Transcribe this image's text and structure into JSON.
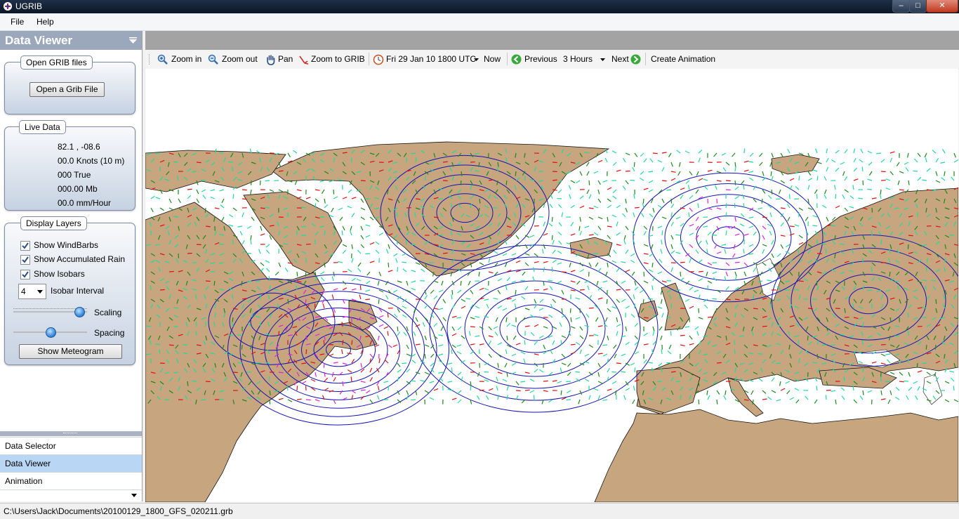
{
  "window": {
    "title": "UGRIB"
  },
  "menu": {
    "file": "File",
    "help": "Help"
  },
  "panel": {
    "title": "Data Viewer",
    "open_group": {
      "legend": "Open GRIB files",
      "button": "Open a Grib File"
    },
    "live_group": {
      "legend": "Live Data",
      "position": "82.1 ,  -08.6",
      "wind_speed": "00.0 Knots (10 m)",
      "wind_dir": "000 True",
      "pressure": "000.00 Mb",
      "rain": "00.0 mm/Hour"
    },
    "layers_group": {
      "legend": "Display Layers",
      "windbarbs": {
        "label": "Show WindBarbs",
        "checked": true
      },
      "rain": {
        "label": "Show Accumulated Rain",
        "checked": true
      },
      "isobars": {
        "label": "Show Isobars",
        "checked": true
      },
      "isobar_interval": {
        "value": "4",
        "label": "Isobar Interval"
      },
      "scaling": {
        "label": "Scaling",
        "level": 0.95
      },
      "spacing": {
        "label": "Spacing",
        "level": 0.5
      },
      "meteogram_button": "Show Meteogram"
    }
  },
  "nav": [
    "Data Selector",
    "Data Viewer",
    "Animation"
  ],
  "toolbar": {
    "zoom_in": "Zoom in",
    "zoom_out": "Zoom out",
    "pan": "Pan",
    "zoom_grib": "Zoom to GRIB",
    "datetime": "Fri 29 Jan 10 1800 UTC",
    "now": "Now",
    "previous": "Previous",
    "step": "3 Hours",
    "next": "Next",
    "create_animation": "Create Animation"
  },
  "status": {
    "file_path": "C:\\Users\\Jack\\Documents\\20100129_1800_GFS_020211.grb"
  },
  "colors": {
    "land": "#c7a67f",
    "sea": "#ffffff",
    "isobar": "#1414b4",
    "barb_light": "#22d89a",
    "barb_moderate": "#1a8a1a",
    "barb_strong": "#e01010",
    "barb_gale": "#e020e0"
  }
}
